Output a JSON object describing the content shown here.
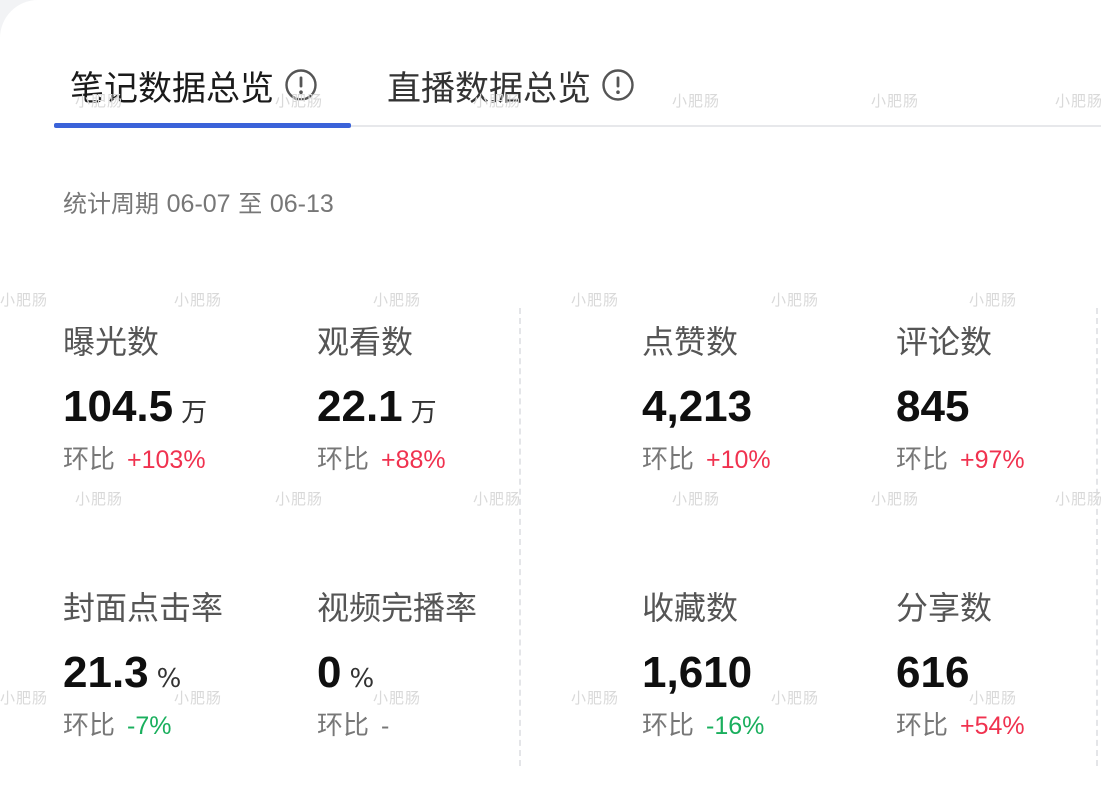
{
  "tabs": [
    {
      "label": "笔记数据总览",
      "active": true
    },
    {
      "label": "直播数据总览",
      "active": false
    }
  ],
  "period": {
    "label": "统计周期",
    "start": "06-07",
    "separator": "至",
    "end": "06-13"
  },
  "metrics": [
    {
      "label": "曝光数",
      "value": "104.5",
      "unit": "万",
      "change_label": "环比",
      "change": "+103%",
      "trend": "up"
    },
    {
      "label": "观看数",
      "value": "22.1",
      "unit": "万",
      "change_label": "环比",
      "change": "+88%",
      "trend": "up"
    },
    {
      "label": "点赞数",
      "value": "4,213",
      "unit": "",
      "change_label": "环比",
      "change": "+10%",
      "trend": "up"
    },
    {
      "label": "评论数",
      "value": "845",
      "unit": "",
      "change_label": "环比",
      "change": "+97%",
      "trend": "up"
    },
    {
      "label": "封面点击率",
      "value": "21.3",
      "unit": "%",
      "change_label": "环比",
      "change": "-7%",
      "trend": "down"
    },
    {
      "label": "视频完播率",
      "value": "0",
      "unit": "%",
      "change_label": "环比",
      "change": "-",
      "trend": "none"
    },
    {
      "label": "收藏数",
      "value": "1,610",
      "unit": "",
      "change_label": "环比",
      "change": "-16%",
      "trend": "down"
    },
    {
      "label": "分享数",
      "value": "616",
      "unit": "",
      "change_label": "环比",
      "change": "+54%",
      "trend": "up"
    }
  ],
  "watermark": "小肥肠",
  "colors": {
    "accent": "#3b63d9",
    "up": "#f0324f",
    "down": "#1aaf5d"
  },
  "icons": {
    "tab_info": "info-circle-icon"
  }
}
